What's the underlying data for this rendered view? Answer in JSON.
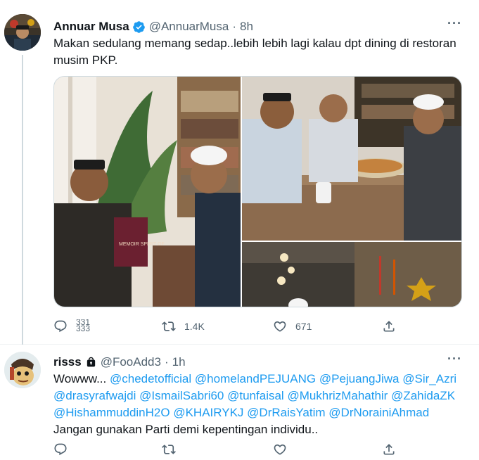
{
  "tweet1": {
    "name": "Annuar Musa",
    "handle": "@AnnuarMusa",
    "separator": "·",
    "time": "8h",
    "more": "···",
    "text_line1": "Makan sedulang memang sedap..lebih lebih lagi kalau dpt dining di restoran",
    "text_line2": "musim PKP.",
    "book_title": "MEMOIR SPIRIT OF",
    "replies": "331",
    "replies_partial": "333",
    "retweets": "1.4K",
    "likes": "671"
  },
  "tweet2": {
    "name": "risss",
    "handle": "@FooAdd3",
    "separator": "·",
    "time": "1h",
    "more": "···",
    "lead": "Wowww... ",
    "mentions": [
      "@chedetofficial",
      "@homelandPEJUANG",
      "@PejuangJiwa",
      "@Sir_Azri",
      "@drasyrafwajdi",
      "@IsmailSabri60",
      "@tunfaisal",
      "@MukhrizMahathir",
      "@ZahidaZK",
      "@HishammuddinH2O",
      "@KHAIRYKJ",
      "@DrRaisYatim",
      "@DrNorainiAhmad"
    ],
    "closing": "Jangan gunakan Parti demi kepentingan individu.."
  },
  "colors": {
    "accent": "#1d9bf0",
    "text": "#0f1419",
    "secondary": "#536471",
    "divider": "#eff3f4"
  },
  "icons": [
    "verified-badge-icon",
    "lock-icon",
    "more-icon",
    "reply-icon",
    "retweet-icon",
    "like-icon",
    "share-icon"
  ]
}
